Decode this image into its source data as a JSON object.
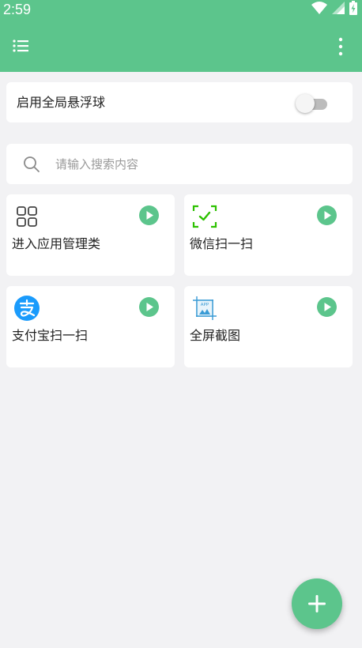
{
  "status_bar": {
    "time": "2:59",
    "icons": [
      "wifi-icon",
      "signal-icon",
      "battery-icon"
    ]
  },
  "app_bar": {
    "menu_icon": "menu-list-icon",
    "more_icon": "more-vert-icon"
  },
  "global_float": {
    "label": "启用全局悬浮球",
    "enabled": false
  },
  "search": {
    "placeholder": "请输入搜索内容",
    "value": ""
  },
  "tiles": [
    {
      "label": "进入应用管理类",
      "icon": "apps-grid-icon"
    },
    {
      "label": "微信扫一扫",
      "icon": "wechat-scan-icon"
    },
    {
      "label": "支付宝扫一扫",
      "icon": "alipay-icon"
    },
    {
      "label": "全屏截图",
      "icon": "screenshot-icon"
    }
  ],
  "fab": {
    "icon": "plus-icon"
  },
  "colors": {
    "accent": "#5cc58c",
    "background": "#f2f2f4",
    "card": "#ffffff",
    "wechat_green": "#2dc100",
    "alipay_blue": "#1a9bfc",
    "screenshot_blue": "#3a9bd5"
  }
}
